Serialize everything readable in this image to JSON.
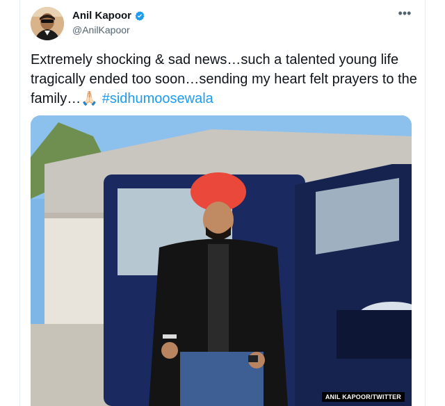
{
  "tweet": {
    "author_name": "Anil Kapoor",
    "handle": "@AnilKapoor",
    "text": "Extremely shocking & sad news…such a talented young life tragically ended too soon…sending my heart felt prayers to the family…🙏🏻",
    "hashtag": "#sidhumoosewala"
  },
  "icons": {
    "verified": "verified-badge-icon",
    "more": "more-options-icon"
  },
  "media": {
    "credit": "ANIL KAPOOR/TWITTER"
  },
  "colors": {
    "link": "#1d9bf0",
    "verified": "#1d9bf0",
    "text": "#0f1419",
    "secondary": "#536471"
  }
}
